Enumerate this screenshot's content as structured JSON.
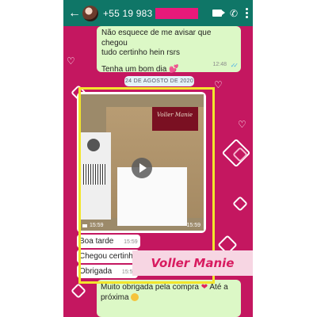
{
  "header": {
    "back_icon": "arrow-left-icon",
    "phone": "+55 19 983",
    "actions": [
      "video-call-icon",
      "phone-icon",
      "more-vert-icon"
    ],
    "bar_color": "#0f7667"
  },
  "messages": {
    "m1_line1": "Não esquece de me avisar que chegou",
    "m1_line2": "tudo certinho hein rsrs",
    "m1_line3": "Tenha um bom dia",
    "m1_time": "12:48"
  },
  "date_separator": "24 DE AGOSTO DE 2020",
  "video": {
    "brand_label": "Voller Manie",
    "duration": "15:59",
    "time": "15:59"
  },
  "replies": [
    {
      "text": "Boa tarde",
      "time": "15:59"
    },
    {
      "text": "Chegou certinho",
      "time": ""
    },
    {
      "text": "Obrigada",
      "time": "15:59"
    }
  ],
  "watermark": "Voller Manie",
  "last_message": {
    "line1": "Muito obrigada pela compra",
    "line2": "Até a",
    "line3": "próxima"
  },
  "colors": {
    "wallpaper": "#c41760",
    "highlight": "#f2e52c"
  }
}
